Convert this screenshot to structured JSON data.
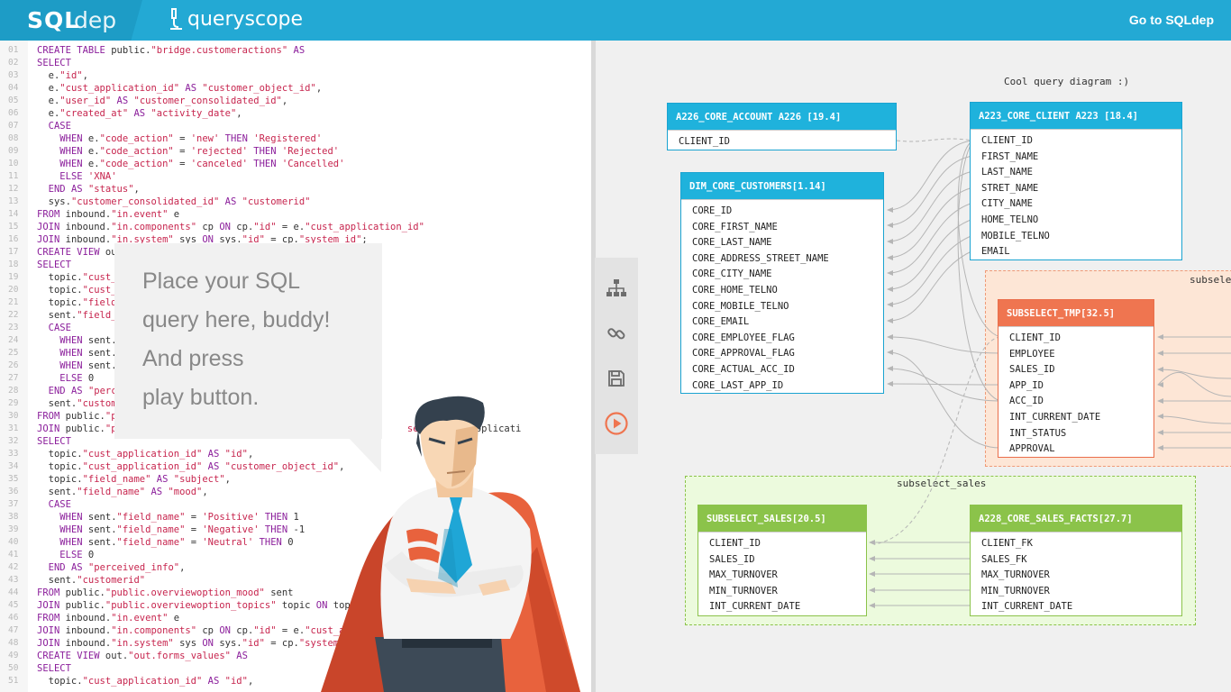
{
  "header": {
    "brand_sql": "SQL",
    "brand_dep": "dep",
    "product_name": "queryscope",
    "goto_link": "Go to SQLdep"
  },
  "editor": {
    "lines": [
      {
        "n": "01",
        "t": "CREATE TABLE public.\"bridge.customeractions\" AS"
      },
      {
        "n": "02",
        "t": "SELECT"
      },
      {
        "n": "03",
        "t": "  e.\"id\","
      },
      {
        "n": "04",
        "t": "  e.\"cust_application_id\" AS \"customer_object_id\","
      },
      {
        "n": "05",
        "t": "  e.\"user_id\" AS \"customer_consolidated_id\","
      },
      {
        "n": "06",
        "t": "  e.\"created_at\" AS \"activity_date\","
      },
      {
        "n": "07",
        "t": "  CASE"
      },
      {
        "n": "08",
        "t": "    WHEN e.\"code_action\" = 'new' THEN 'Registered'"
      },
      {
        "n": "09",
        "t": "    WHEN e.\"code_action\" = 'rejected' THEN 'Rejected'"
      },
      {
        "n": "10",
        "t": "    WHEN e.\"code_action\" = 'canceled' THEN 'Cancelled'"
      },
      {
        "n": "11",
        "t": "    ELSE 'XNA'"
      },
      {
        "n": "12",
        "t": "  END AS \"status\","
      },
      {
        "n": "13",
        "t": "  sys.\"customer_consolidated_id\" AS \"customerid\""
      },
      {
        "n": "14",
        "t": "FROM inbound.\"in.event\" e"
      },
      {
        "n": "15",
        "t": "JOIN inbound.\"in.components\" cp ON cp.\"id\" = e.\"cust_application_id\""
      },
      {
        "n": "16",
        "t": "JOIN inbound.\"in.system\" sys ON sys.\"id\" = cp.\"system_id\";"
      },
      {
        "n": "17",
        "t": "CREATE VIEW out."
      },
      {
        "n": "18",
        "t": "SELECT"
      },
      {
        "n": "19",
        "t": "  topic.\"cust_"
      },
      {
        "n": "20",
        "t": "  topic.\"cust_"
      },
      {
        "n": "21",
        "t": "  topic.\"field_"
      },
      {
        "n": "22",
        "t": "  sent.\"field_n"
      },
      {
        "n": "23",
        "t": "  CASE"
      },
      {
        "n": "24",
        "t": "    WHEN sent."
      },
      {
        "n": "25",
        "t": "    WHEN sent."
      },
      {
        "n": "26",
        "t": "    WHEN sent."
      },
      {
        "n": "27",
        "t": "    ELSE 0"
      },
      {
        "n": "28",
        "t": "  END AS \"perce"
      },
      {
        "n": "29",
        "t": "  sent.\"custom"
      },
      {
        "n": "30",
        "t": "FROM public.\"p"
      },
      {
        "n": "31",
        "t": "JOIN public.\"p                                  applica          sent.\"cust_applicati"
      },
      {
        "n": "32",
        "t": "SELECT"
      },
      {
        "n": "33",
        "t": "  topic.\"cust_application_id\" AS \"id\","
      },
      {
        "n": "34",
        "t": "  topic.\"cust_application_id\" AS \"customer_object_id\","
      },
      {
        "n": "35",
        "t": "  topic.\"field_name\" AS \"subject\","
      },
      {
        "n": "36",
        "t": "  sent.\"field_name\" AS \"mood\","
      },
      {
        "n": "37",
        "t": "  CASE"
      },
      {
        "n": "38",
        "t": "    WHEN sent.\"field_name\" = 'Positive' THEN 1"
      },
      {
        "n": "39",
        "t": "    WHEN sent.\"field_name\" = 'Negative' THEN -1"
      },
      {
        "n": "40",
        "t": "    WHEN sent.\"field_name\" = 'Neutral' THEN 0"
      },
      {
        "n": "41",
        "t": "    ELSE 0"
      },
      {
        "n": "42",
        "t": "  END AS \"perceived_info\","
      },
      {
        "n": "43",
        "t": "  sent.\"customerid\""
      },
      {
        "n": "44",
        "t": "FROM public.\"public.overviewoption_mood\" sent"
      },
      {
        "n": "45",
        "t": "JOIN public.\"public.overviewoption_topics\" topic ON top                          icati"
      },
      {
        "n": "46",
        "t": "FROM inbound.\"in.event\" e"
      },
      {
        "n": "47",
        "t": "JOIN inbound.\"in.components\" cp ON cp.\"id\" = e.\"cust_applicat"
      },
      {
        "n": "48",
        "t": "JOIN inbound.\"in.system\" sys ON sys.\"id\" = cp.\"system_id\";"
      },
      {
        "n": "49",
        "t": "CREATE VIEW out.\"out.forms_values\" AS"
      },
      {
        "n": "50",
        "t": "SELECT"
      },
      {
        "n": "51",
        "t": "  topic.\"cust_application_id\" AS \"id\","
      }
    ]
  },
  "bubble": {
    "line1": "Place your SQL",
    "line2": "query here, buddy!",
    "line3": "And press",
    "line4": "play button."
  },
  "diagram": {
    "title": "Cool query diagram :)",
    "groups": [
      {
        "label": "subselect_tmp",
        "visible_label": "subselec"
      },
      {
        "label": "subselect_sales"
      }
    ],
    "tables": {
      "a226": {
        "name": "A226_CORE_ACCOUNT A226 [19.4]",
        "columns": [
          "CLIENT_ID"
        ]
      },
      "a223": {
        "name": "A223_CORE_CLIENT A223 [18.4]",
        "columns": [
          "CLIENT_ID",
          "FIRST_NAME",
          "LAST_NAME",
          "STRET_NAME",
          "CITY_NAME",
          "HOME_TELNO",
          "MOBILE_TELNO",
          "EMAIL"
        ]
      },
      "dim": {
        "name": "DIM_CORE_CUSTOMERS[1.14]",
        "columns": [
          "CORE_ID",
          "CORE_FIRST_NAME",
          "CORE_LAST_NAME",
          "CORE_ADDRESS_STREET_NAME",
          "CORE_CITY_NAME",
          "CORE_HOME_TELNO",
          "CORE_MOBILE_TELNO",
          "CORE_EMAIL",
          "CORE_EMPLOYEE_FLAG",
          "CORE_APPROVAL_FLAG",
          "CORE_ACTUAL_ACC_ID",
          "CORE_LAST_APP_ID"
        ]
      },
      "tmp": {
        "name": "SUBSELECT_TMP[32.5]",
        "columns": [
          "CLIENT_ID",
          "EMPLOYEE",
          "SALES_ID",
          "APP_ID",
          "ACC_ID",
          "INT_CURRENT_DATE",
          "INT_STATUS",
          "APPROVAL"
        ]
      },
      "sales": {
        "name": "SUBSELECT_SALES[20.5]",
        "columns": [
          "CLIENT_ID",
          "SALES_ID",
          "MAX_TURNOVER",
          "MIN_TURNOVER",
          "INT_CURRENT_DATE"
        ]
      },
      "facts": {
        "name": "A228_CORE_SALES_FACTS[27.7]",
        "columns": [
          "CLIENT_FK",
          "SALES_FK",
          "MAX_TURNOVER",
          "MIN_TURNOVER",
          "INT_CURRENT_DATE"
        ]
      }
    }
  },
  "toolbar": {
    "tools": [
      "hierarchy-icon",
      "link-icon",
      "save-icon",
      "play-icon"
    ]
  },
  "colors": {
    "header": "#23a9d4",
    "blue_table": "#1fb2dc",
    "orange_table": "#ef7550",
    "green_table": "#8bc34a",
    "play": "#ef7550"
  }
}
